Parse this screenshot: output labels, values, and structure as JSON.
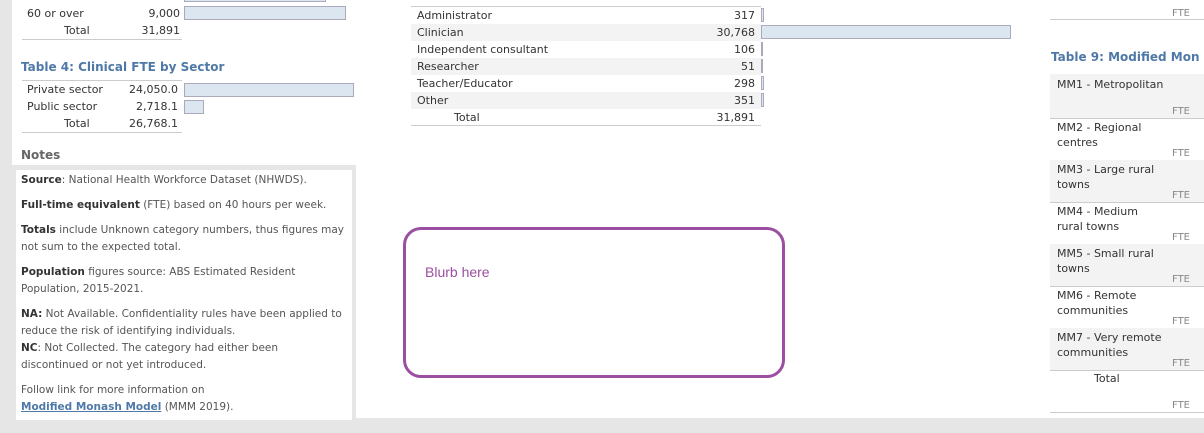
{
  "left_top": {
    "rows": [
      {
        "label": "60 or over",
        "value": "9,000",
        "fraction": 1.0
      }
    ],
    "total_label": "Total",
    "total_value": "31,891"
  },
  "table4": {
    "title": "Table 4:  Clinical FTE by Sector",
    "rows": [
      {
        "label": "Private sector",
        "value": "24,050.0",
        "fraction": 1.0
      },
      {
        "label": "Public sector",
        "value": "2,718.1",
        "fraction": 0.113
      }
    ],
    "total_label": "Total",
    "total_value": "26,768.1"
  },
  "notes": {
    "title": "Notes",
    "source_b": "Source",
    "source_t": ": National Health Workforce Dataset (NHWDS).",
    "fte_b": "Full-time equivalent",
    "fte_t": " (FTE) based on 40 hours per week.",
    "totals_b": "Totals",
    "totals_t": " include Unknown category numbers, thus figures may not sum to the expected total.",
    "pop_b": "Population",
    "pop_t": " figures source: ABS Estimated Resident Population, 2015-2021.",
    "na_b": "NA:",
    "na_t": " Not Available. Confidentiality rules have been applied to reduce the risk of identifying individuals.",
    "nc_b": "NC",
    "nc_t": ": Not Collected.  The category had either been discontinued or not yet introduced.",
    "follow_t": "Follow link for more information on",
    "link_t": "Modified Monash Model",
    "link_suffix": " (MMM 2019)."
  },
  "roles": {
    "rows": [
      {
        "label": "Administrator",
        "value": "317",
        "fraction": 0.0103
      },
      {
        "label": "Clinician",
        "value": "30,768",
        "fraction": 1.0
      },
      {
        "label": "Independent consultant",
        "value": "106",
        "fraction": 0.0034
      },
      {
        "label": "Researcher",
        "value": "51",
        "fraction": 0.0017
      },
      {
        "label": "Teacher/Educator",
        "value": "298",
        "fraction": 0.0097
      },
      {
        "label": "Other",
        "value": "351",
        "fraction": 0.0114
      }
    ],
    "total_label": "Total",
    "total_value": "31,891"
  },
  "blurb": {
    "text": "Blurb here",
    "border_color": "#9b4fa1",
    "text_color": "#9b4fa1"
  },
  "table9": {
    "title": "Table 9:  Modified Mon",
    "top_fte": "FTE",
    "rows": [
      {
        "label": "MM1 - Metropolitan",
        "fte": "FTE"
      },
      {
        "label": "MM2 - Regional centres",
        "fte": "FTE"
      },
      {
        "label": "MM3 - Large rural towns",
        "fte": "FTE"
      },
      {
        "label": "MM4 - Medium rural towns",
        "fte": "FTE"
      },
      {
        "label": "MM5 - Small rural towns",
        "fte": "FTE"
      },
      {
        "label": "MM6 - Remote communities",
        "fte": "FTE"
      },
      {
        "label": "MM7 - Very remote communities",
        "fte": "FTE"
      }
    ],
    "total_label": "Total",
    "total_fte": "FTE"
  },
  "colors": {
    "heading": "#4e79a7",
    "bar_fill": "#dce6f1"
  }
}
